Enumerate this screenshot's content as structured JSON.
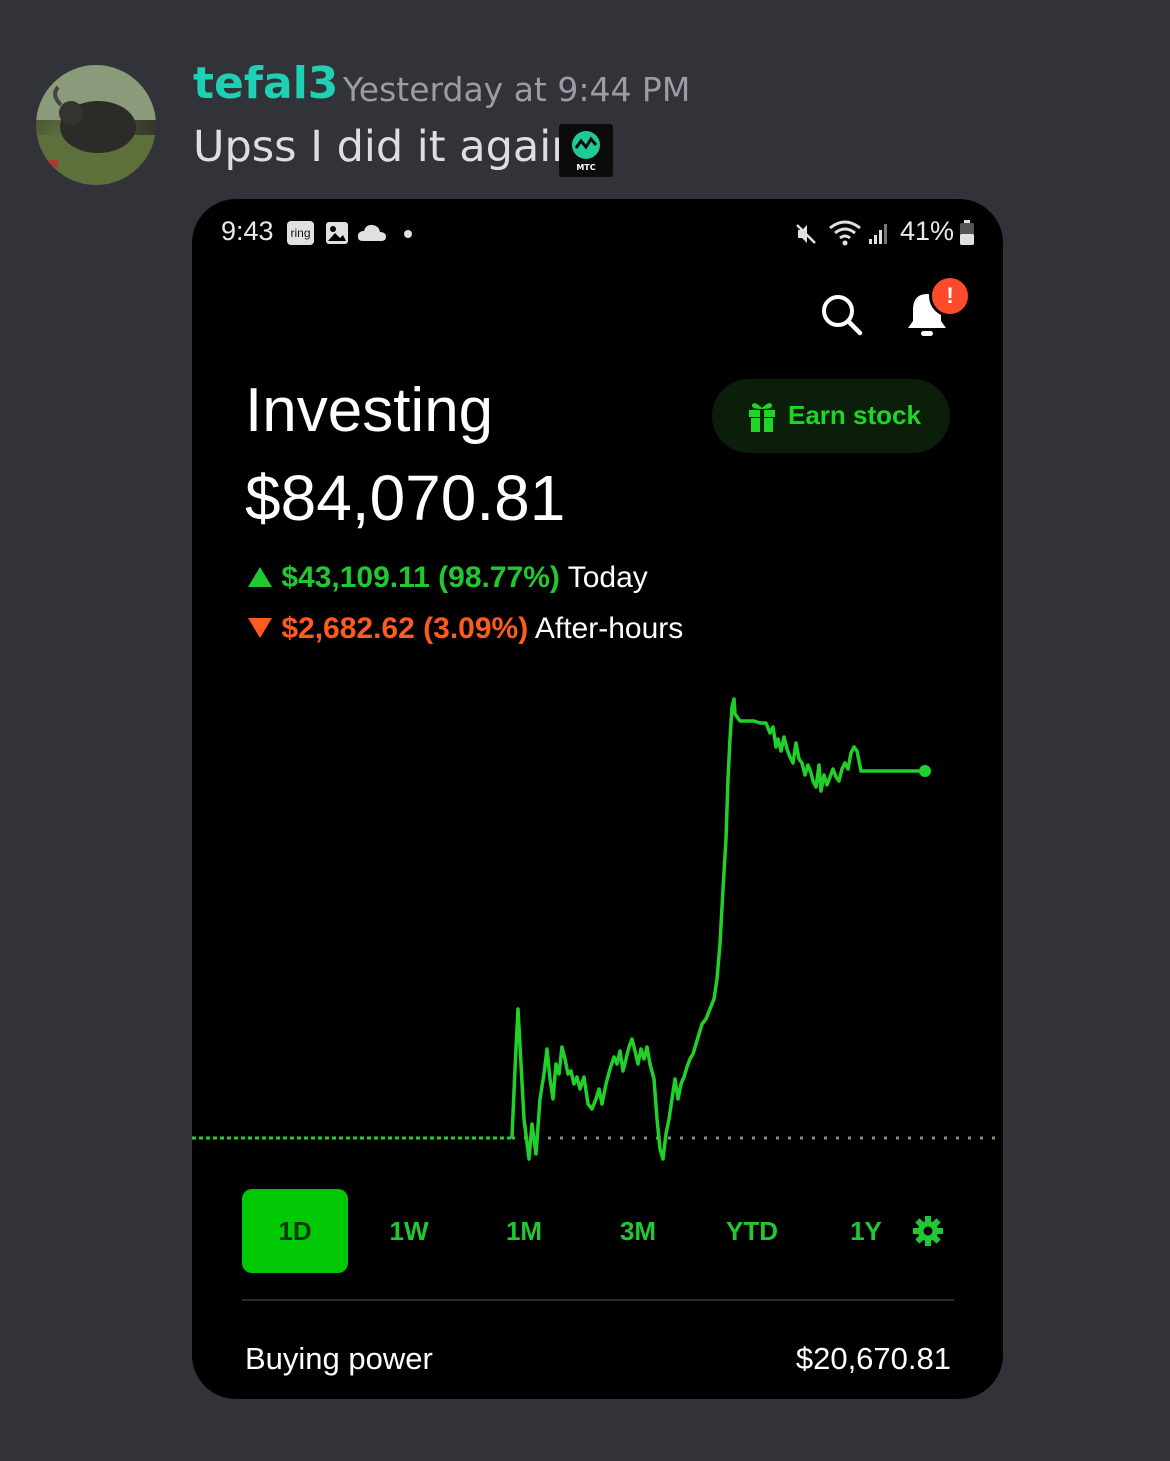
{
  "message": {
    "author": "tefal3",
    "timestamp": "Yesterday at 9:44 PM",
    "text": "Upss I did it again",
    "emoji_label": "MTC",
    "author_color": "#1ed1b4"
  },
  "status_bar": {
    "time": "9:43",
    "ring_label": "ring",
    "battery": "41%"
  },
  "header": {
    "notification_badge": "!",
    "earn_stock_label": "Earn stock"
  },
  "portfolio": {
    "title": "Investing",
    "value": "$84,070.81",
    "today_change": "$43,109.11 (98.77%)",
    "today_label": "Today",
    "afterhours_change": "$2,682.62 (3.09%)",
    "afterhours_label": "After-hours",
    "up_color": "#21c832",
    "down_color": "#ff5a1f"
  },
  "chart_data": {
    "type": "line",
    "x_labels": [],
    "series_color": "#21d12a",
    "baseline_style": "dotted",
    "shape": "flat at previous close, volatile midday, sharp spike up, then settling"
  },
  "range_tabs": [
    {
      "label": "1D",
      "active": true
    },
    {
      "label": "1W",
      "active": false
    },
    {
      "label": "1M",
      "active": false
    },
    {
      "label": "3M",
      "active": false
    },
    {
      "label": "YTD",
      "active": false
    },
    {
      "label": "1Y",
      "active": false
    }
  ],
  "buying_power": {
    "label": "Buying power",
    "value": "$20,670.81"
  }
}
